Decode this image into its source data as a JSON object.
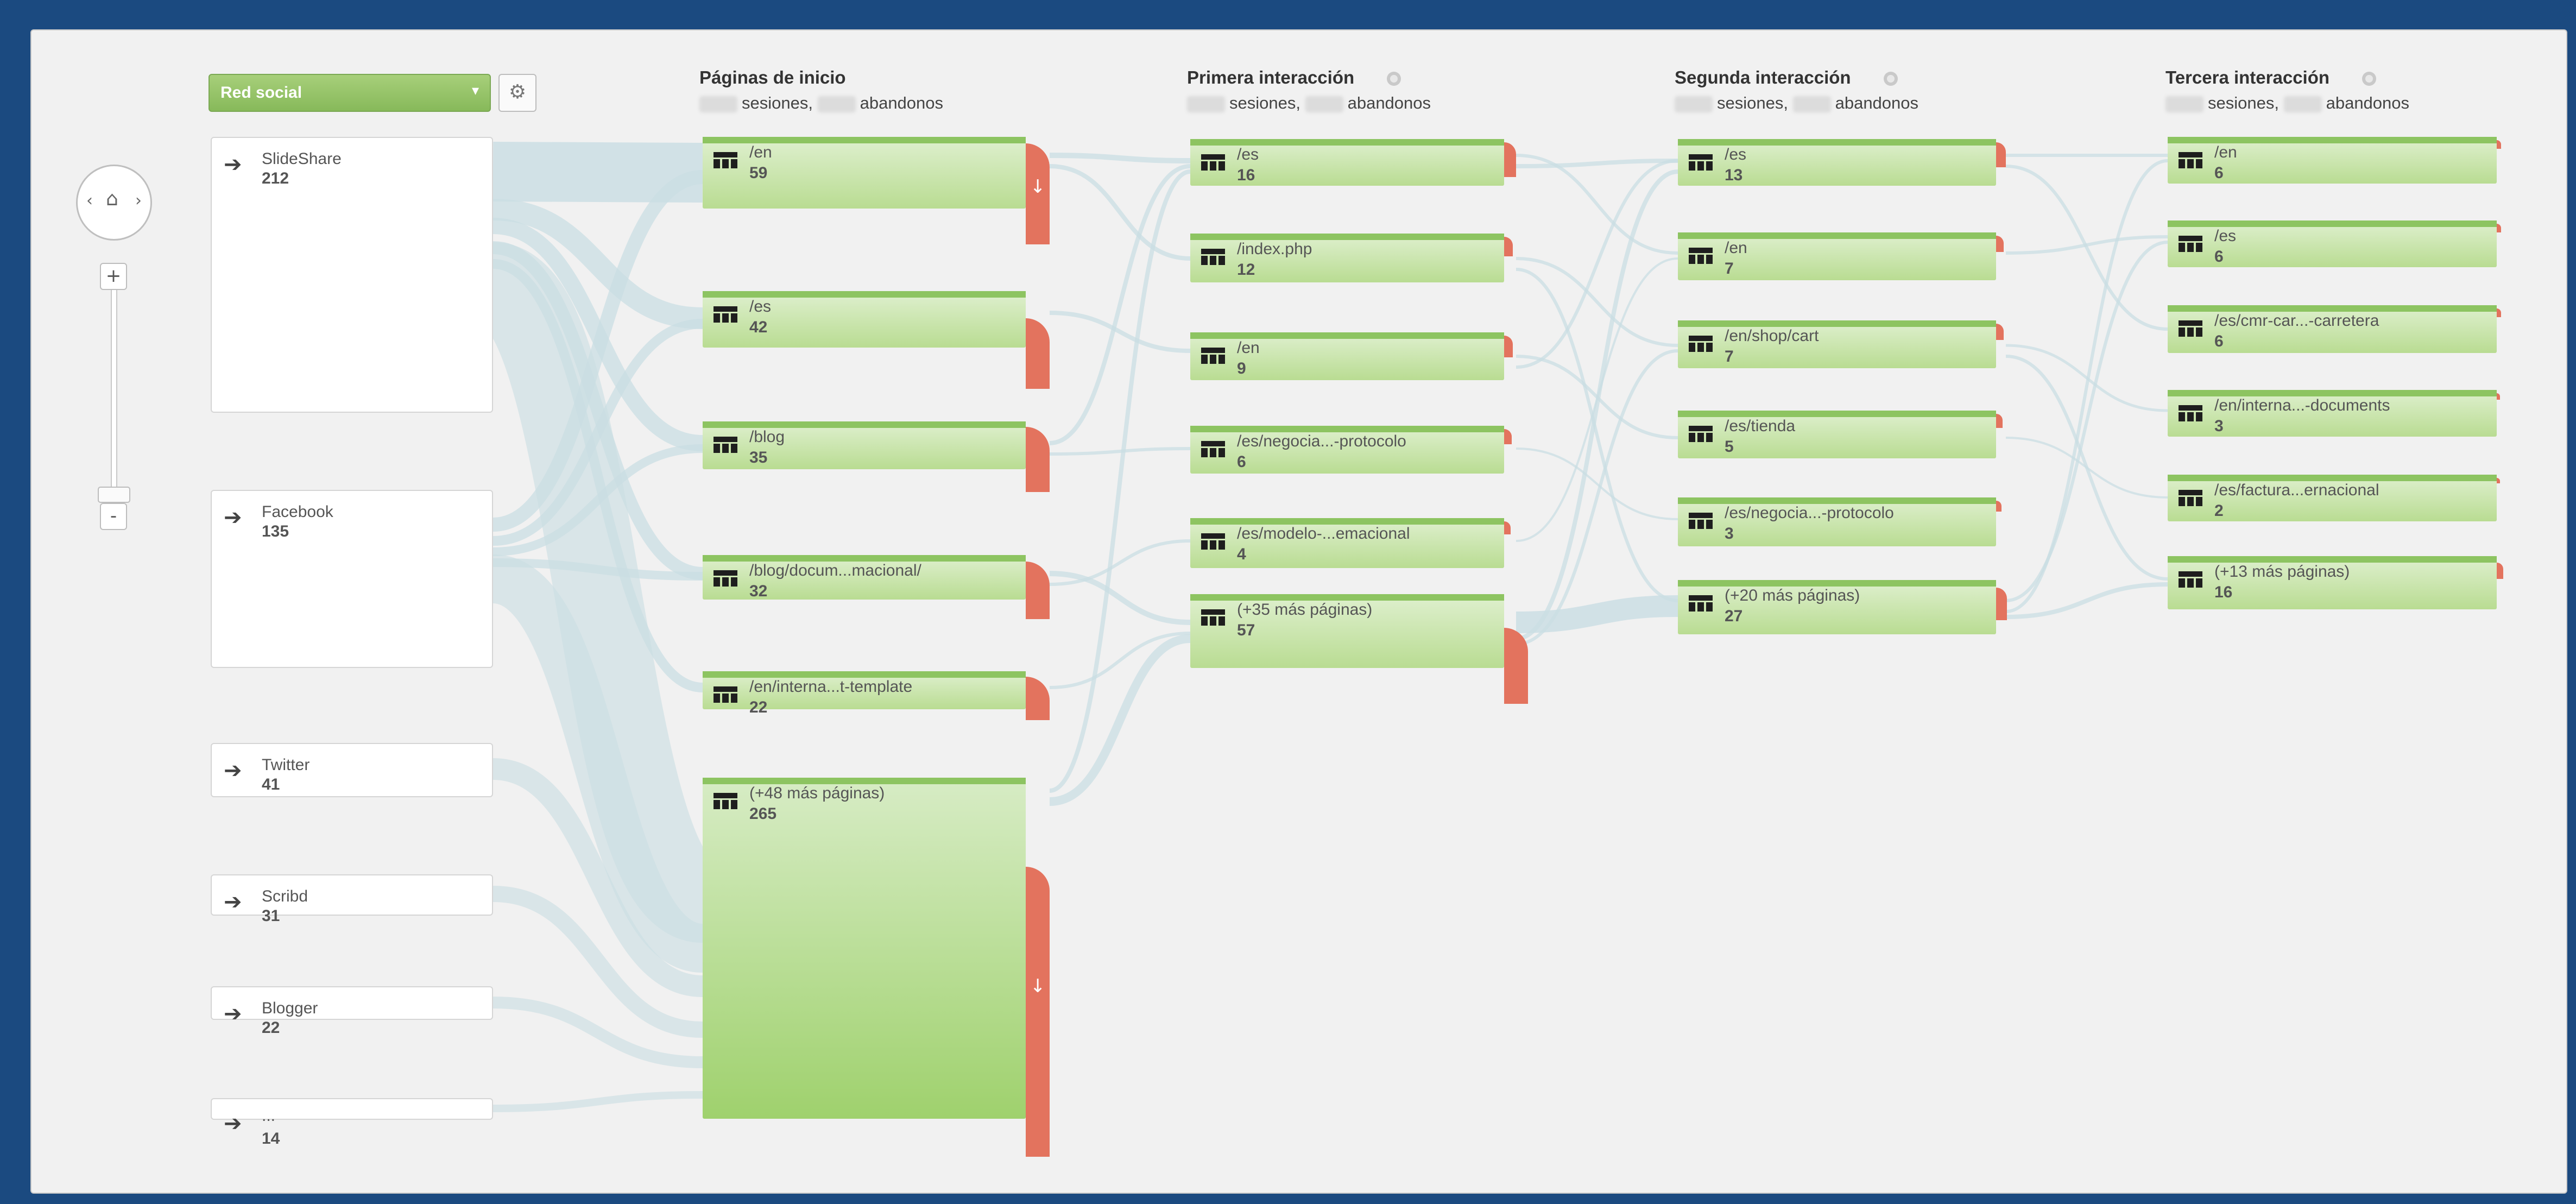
{
  "dimension": {
    "label": "Red social"
  },
  "nav": {
    "home_icon": "home-icon",
    "left_icon": "chevron-left-icon",
    "right_icon": "chevron-right-icon",
    "zoom_in_label": "+",
    "zoom_out_label": "-"
  },
  "columns": [
    {
      "title": "Páginas de inicio",
      "sessions_label": "sesiones,",
      "dropoffs_label": "abandonos"
    },
    {
      "title": "Primera interacción",
      "sessions_label": "sesiones,",
      "dropoffs_label": "abandonos"
    },
    {
      "title": "Segunda interacción",
      "sessions_label": "sesiones,",
      "dropoffs_label": "abandonos"
    },
    {
      "title": "Tercera interacción",
      "sessions_label": "sesiones,",
      "dropoffs_label": "abandonos"
    }
  ],
  "sources": [
    {
      "name": "SlideShare",
      "count": "212"
    },
    {
      "name": "Facebook",
      "count": "135"
    },
    {
      "name": "Twitter",
      "count": "41"
    },
    {
      "name": "Scribd",
      "count": "31"
    },
    {
      "name": "Blogger",
      "count": "22"
    },
    {
      "name": "...",
      "count": "14"
    }
  ],
  "landing": [
    {
      "name": "/en",
      "count": "59"
    },
    {
      "name": "/es",
      "count": "42"
    },
    {
      "name": "/blog",
      "count": "35"
    },
    {
      "name": "/blog/docum...macional/",
      "count": "32"
    },
    {
      "name": "/en/interna...t-template",
      "count": "22"
    },
    {
      "name": "(+48 más páginas)",
      "count": "265"
    }
  ],
  "first": [
    {
      "name": "/es",
      "count": "16"
    },
    {
      "name": "/index.php",
      "count": "12"
    },
    {
      "name": "/en",
      "count": "9"
    },
    {
      "name": "/es/negocia...-protocolo",
      "count": "6"
    },
    {
      "name": "/es/modelo-...emacional",
      "count": "4"
    },
    {
      "name": "(+35 más páginas)",
      "count": "57"
    }
  ],
  "second": [
    {
      "name": "/es",
      "count": "13"
    },
    {
      "name": "/en",
      "count": "7"
    },
    {
      "name": "/en/shop/cart",
      "count": "7"
    },
    {
      "name": "/es/tienda",
      "count": "5"
    },
    {
      "name": "/es/negocia...-protocolo",
      "count": "3"
    },
    {
      "name": "(+20 más páginas)",
      "count": "27"
    }
  ],
  "third": [
    {
      "name": "/en",
      "count": "6"
    },
    {
      "name": "/es",
      "count": "6"
    },
    {
      "name": "/es/cmr-car...-carretera",
      "count": "6"
    },
    {
      "name": "/en/interna...-documents",
      "count": "3"
    },
    {
      "name": "/es/factura...ernacional",
      "count": "2"
    },
    {
      "name": "(+13 más páginas)",
      "count": "16"
    }
  ],
  "colors": {
    "background": "#1b4a80",
    "node_green": "#8dc461",
    "dropoff_red": "#e3735e",
    "link": "#c9dde3"
  }
}
